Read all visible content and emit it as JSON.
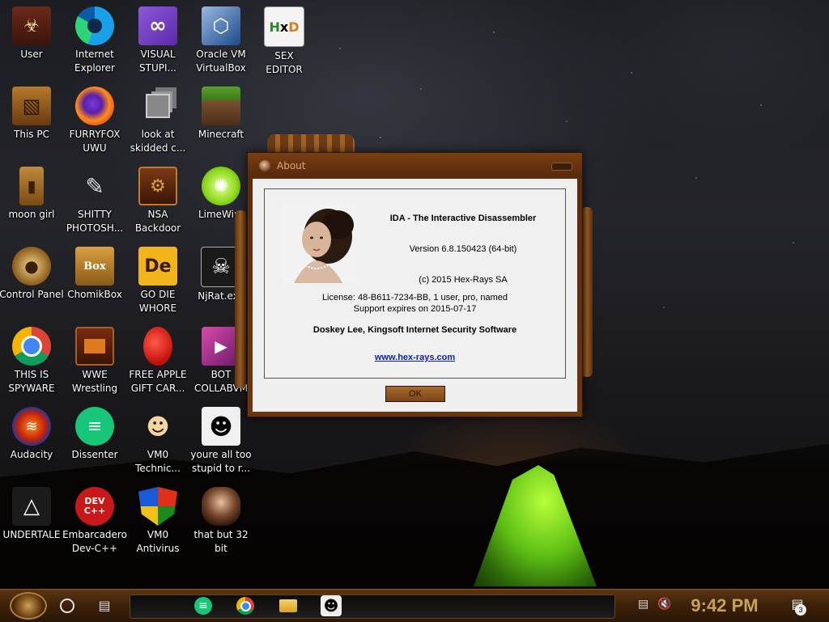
{
  "desktop": {
    "icons": [
      {
        "label": "User"
      },
      {
        "label": "Internet\nExplorer"
      },
      {
        "label": "VISUAL\nSTUPI..."
      },
      {
        "label": "Oracle VM\nVirtualBox"
      },
      {
        "label": "SEX\nEDITOR"
      },
      {
        "label": "This PC"
      },
      {
        "label": "FURRYFOX\nUWU"
      },
      {
        "label": "look at\nskidded c..."
      },
      {
        "label": "Minecraft"
      },
      {
        "label": "moon girl"
      },
      {
        "label": "SHITTY\nPHOTOSH..."
      },
      {
        "label": "NSA\nBackdoor"
      },
      {
        "label": "LimeWire"
      },
      {
        "label": "Control Panel"
      },
      {
        "label": "ChomikBox"
      },
      {
        "label": "GO DIE\nWHORE"
      },
      {
        "label": "NjRat.exe"
      },
      {
        "label": "THIS IS\nSPYWARE"
      },
      {
        "label": "WWE\nWrestling"
      },
      {
        "label": "FREE APPLE\nGIFT CAR..."
      },
      {
        "label": "BOT\nCOLLABVM"
      },
      {
        "label": "Audacity"
      },
      {
        "label": "Dissenter"
      },
      {
        "label": "VM0\nTechnic..."
      },
      {
        "label": "youre all too\nstupid to r..."
      },
      {
        "label": "UNDERTALE"
      },
      {
        "label": "Embarcadero\nDev-C++"
      },
      {
        "label": "VM0\nAntivirus"
      },
      {
        "label": "that but 32\nbit"
      }
    ]
  },
  "about_dialog": {
    "title": "About",
    "product": "IDA - The Interactive Disassembler",
    "version": "Version 6.8.150423 (64-bit)",
    "copyright": "(c) 2015 Hex-Rays SA",
    "license": "License: 48-B611-7234-BB, 1 user, pro, named",
    "support": "Support expires on 2015-07-17",
    "licensee": "Doskey Lee, Kingsoft Internet Security Software",
    "website": "www.hex-rays.com",
    "ok_label": "OK"
  },
  "taskbar": {
    "clock": "9:42 PM",
    "notification_count": "3"
  },
  "colors": {
    "accent": "#c7a25a",
    "frame": "#6b3510",
    "link": "#0a1fa8"
  }
}
